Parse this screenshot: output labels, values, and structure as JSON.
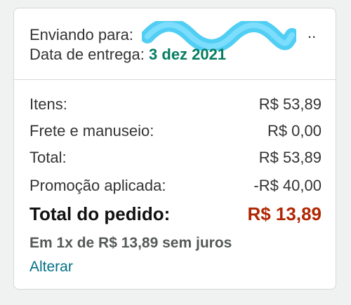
{
  "shipping": {
    "to_label": "Enviando para:",
    "address_ellipsis": "..",
    "delivery_label": "Data de entrega:",
    "delivery_date": "3 dez 2021"
  },
  "summary": {
    "rows": [
      {
        "label": "Itens:",
        "value": "R$ 53,89"
      },
      {
        "label": "Frete e manuseio:",
        "value": "R$ 0,00"
      },
      {
        "label": "Total:",
        "value": "R$ 53,89"
      },
      {
        "label": "Promoção aplicada:",
        "value": "-R$ 40,00"
      }
    ],
    "order_total_label": "Total do pedido:",
    "order_total_value": "R$ 13,89",
    "installments": "Em 1x de R$ 13,89 sem juros",
    "change_link": "Alterar"
  },
  "colors": {
    "delivery_date": "#067d62",
    "order_total": "#b12704",
    "link": "#007185",
    "redaction_scribble": "#3ec9f2"
  }
}
